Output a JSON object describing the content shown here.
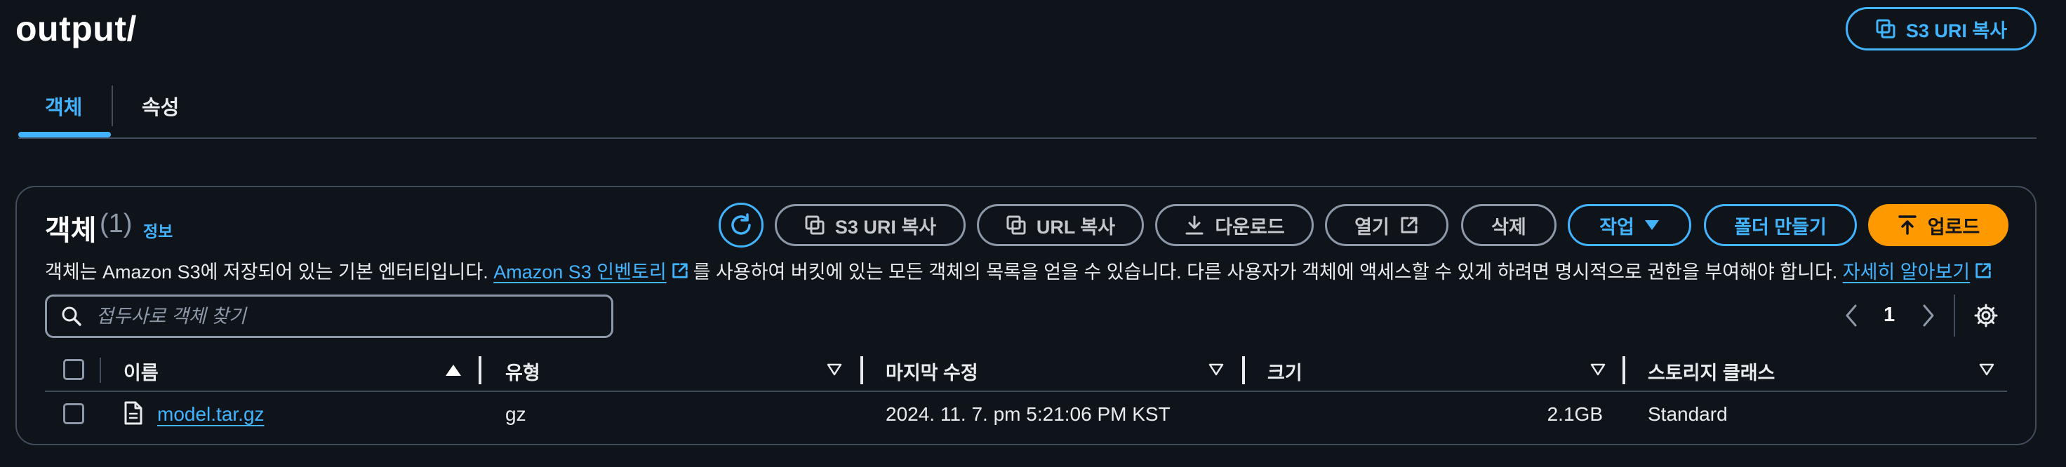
{
  "header": {
    "title": "output/",
    "copy_s3_uri_label": "S3 URI 복사"
  },
  "tabs": [
    {
      "label": "객체",
      "active": true
    },
    {
      "label": "속성",
      "active": false
    }
  ],
  "objects_panel": {
    "title": "객체",
    "count": "(1)",
    "info_link": "정보",
    "toolbar": {
      "refresh_icon": "refresh-icon",
      "copy_s3_uri": "S3 URI 복사",
      "copy_url": "URL 복사",
      "download": "다운로드",
      "open": "열기",
      "delete": "삭제",
      "actions": "작업",
      "create_folder": "폴더 만들기",
      "upload": "업로드"
    },
    "description": {
      "before": "객체는 Amazon S3에 저장되어 있는 기본 엔터티입니다. ",
      "inventory_link": "Amazon S3 인벤토리",
      "middle": "를 사용하여 버킷에 있는 모든 객체의 목록을 얻을 수 있습니다. 다른 사용자가 객체에 액세스할 수 있게 하려면 명시적으로 권한을 부여해야 합니다. ",
      "learn_more_link": "자세히 알아보기"
    },
    "search": {
      "placeholder": "접두사로 객체 찾기",
      "value": ""
    },
    "pagination": {
      "page": "1"
    },
    "table": {
      "columns": [
        "이름",
        "유형",
        "마지막 수정",
        "크기",
        "스토리지 클래스"
      ],
      "rows": [
        {
          "name": "model.tar.gz",
          "type": "gz",
          "last_modified": "2024. 11. 7. pm 5:21:06 PM KST",
          "size": "2.1GB",
          "storage_class": "Standard"
        }
      ]
    }
  },
  "colors": {
    "background": "#0f141a",
    "accent": "#42b4ff",
    "primary_button": "#ff9900",
    "border": "#414d5c",
    "muted": "#8d99a8"
  }
}
